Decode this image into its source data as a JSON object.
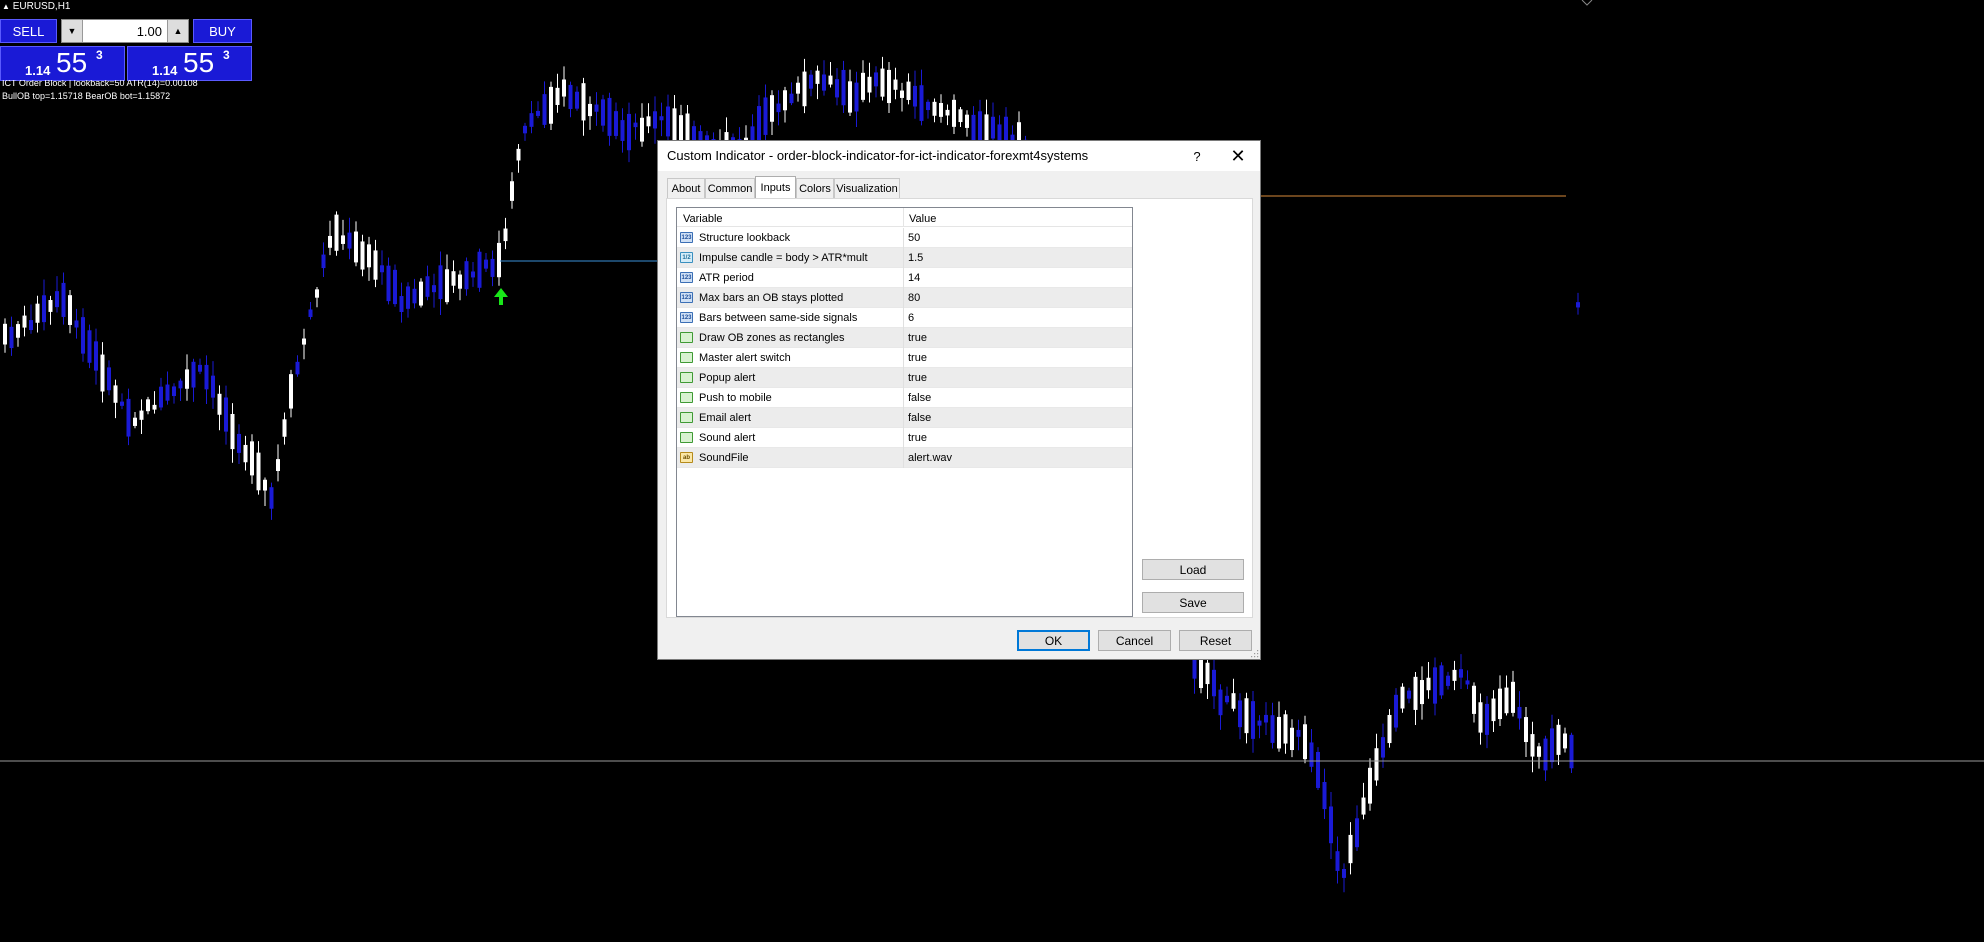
{
  "chart": {
    "symbol": "EURUSD,H1",
    "indicator_line_1": "ICT Order Block | lookback=50 ATR(14)=0.00108",
    "indicator_line_2": "BullOB top=1.15718 BearOB bot=1.15872",
    "background": "#000000",
    "bull_color": "#ffffff",
    "bear_color": "#1a1ad6",
    "arrow_color": "#19e619"
  },
  "trade_panel": {
    "sell_label": "SELL",
    "buy_label": "BUY",
    "lot": "1.00",
    "sell_price": {
      "big": "1.14",
      "large": "55",
      "sup": "3"
    },
    "buy_price": {
      "big": "1.14",
      "large": "55",
      "sup": "3"
    }
  },
  "dialog": {
    "title": "Custom Indicator - order-block-indicator-for-ict-indicator-forexmt4systems",
    "help": "?",
    "close": "✕",
    "tabs": [
      "About",
      "Common",
      "Inputs",
      "Colors",
      "Visualization"
    ],
    "active_tab": "Inputs",
    "columns": {
      "variable": "Variable",
      "value": "Value"
    },
    "inputs": [
      {
        "name": "Structure lookback",
        "value": "50",
        "type": "int"
      },
      {
        "name": "Impulse candle = body > ATR*mult",
        "value": "1.5",
        "type": "dbl"
      },
      {
        "name": "ATR period",
        "value": "14",
        "type": "int"
      },
      {
        "name": "Max bars an OB stays plotted",
        "value": "80",
        "type": "int"
      },
      {
        "name": "Bars between same-side signals",
        "value": "6",
        "type": "int"
      },
      {
        "name": "Draw OB zones as rectangles",
        "value": "true",
        "type": "bool"
      },
      {
        "name": "Master alert switch",
        "value": "true",
        "type": "bool"
      },
      {
        "name": "Popup alert",
        "value": "true",
        "type": "bool"
      },
      {
        "name": "Push to mobile",
        "value": "false",
        "type": "bool"
      },
      {
        "name": "Email alert",
        "value": "false",
        "type": "bool"
      },
      {
        "name": "Sound alert",
        "value": "true",
        "type": "bool"
      },
      {
        "name": "SoundFile",
        "value": "alert.wav",
        "type": "str"
      }
    ],
    "icon_text": {
      "int": "123",
      "dbl": "1/2",
      "bool": "",
      "str": "ab"
    },
    "load_label": "Load",
    "save_label": "Save",
    "ok_label": "OK",
    "cancel_label": "Cancel",
    "reset_label": "Reset"
  }
}
